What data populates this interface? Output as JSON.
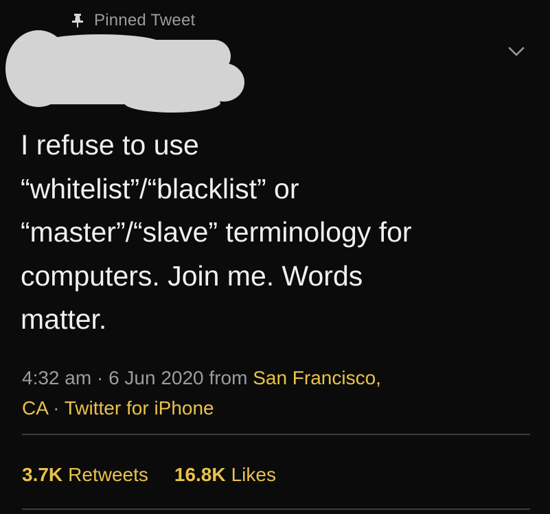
{
  "pinned": {
    "icon": "pin-icon",
    "label": "Pinned Tweet"
  },
  "author": {
    "redacted": true
  },
  "menu": {
    "icon": "chevron-down-icon"
  },
  "tweet": {
    "text": "I refuse to use\n“whitelist”/“blacklist” or\n“master”/“slave” terminology for\ncomputers. Join me. Words\nmatter."
  },
  "meta": {
    "time": "4:32 am",
    "sep1": "·",
    "date": "6 Jun 2020",
    "from": "from",
    "location_line1": "San Francisco,",
    "location_line2": "CA",
    "sep2": "·",
    "source": "Twitter for iPhone"
  },
  "stats": {
    "retweets_count": "3.7K",
    "retweets_label": "Retweets",
    "likes_count": "16.8K",
    "likes_label": "Likes"
  },
  "colors": {
    "background": "#0b0b0b",
    "text": "#f0f0f0",
    "muted": "#9a9ca0",
    "accent": "#e9c24a",
    "divider": "#3b3d40",
    "redaction": "#d3d3d3"
  }
}
